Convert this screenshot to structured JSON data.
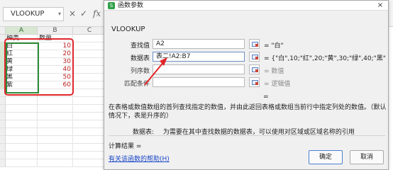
{
  "formula_bar": {
    "name_box": "VLOOKUP",
    "icons": [
      "chevron-down-icon",
      "cancel-icon",
      "check-icon",
      "function-icon"
    ],
    "cancel_glyph": "×",
    "confirm_glyph": "✓",
    "fx_glyph": "fx"
  },
  "sheet": {
    "columns": [
      "A",
      "B",
      "C"
    ],
    "header_row": {
      "a": "种类",
      "b": "数量"
    },
    "rows": [
      {
        "a": "白",
        "b": "10"
      },
      {
        "a": "红",
        "b": "20"
      },
      {
        "a": "黄",
        "b": "30"
      },
      {
        "a": "绿",
        "b": "40"
      },
      {
        "a": "黑",
        "b": "50"
      },
      {
        "a": "紫",
        "b": "60"
      }
    ],
    "colors": {
      "value_red": "#b8211e",
      "selection_green": "#2e8b37",
      "highlight_red": "#e0262a"
    }
  },
  "dialog": {
    "title": "函数参数",
    "close_glyph": "×",
    "function_name": "VLOOKUP",
    "args": [
      {
        "label": "查找值",
        "value": "A2",
        "result": "= \"白\""
      },
      {
        "label": "数据表",
        "value": "表二!A2:B7",
        "result": "= {\"白\",10;\"红\",20;\"黄\",30;\"绿\",40;\"黑\",50;\"..."
      },
      {
        "label": "列序数",
        "value": "",
        "result": "= 数值"
      },
      {
        "label": "匹配条件",
        "value": "",
        "result": "= 逻辑值"
      }
    ],
    "equals": "=",
    "description": "在表格或数值数组的首列查找指定的数值，并由此返回表格或数组当前行中指定列处的数值。（默认情况下，表是升序的）",
    "param_name": "数据表:",
    "param_desc": "为需要在其中查找数据的数据表，可以使用对区域或区域名称的引用",
    "calc_result": "计算结果 =",
    "help_link": "有关该函数的帮助(H)",
    "ok": "确定",
    "cancel": "取消",
    "colors": {
      "link": "#1a46c8",
      "accent": "#2fa04a"
    }
  }
}
